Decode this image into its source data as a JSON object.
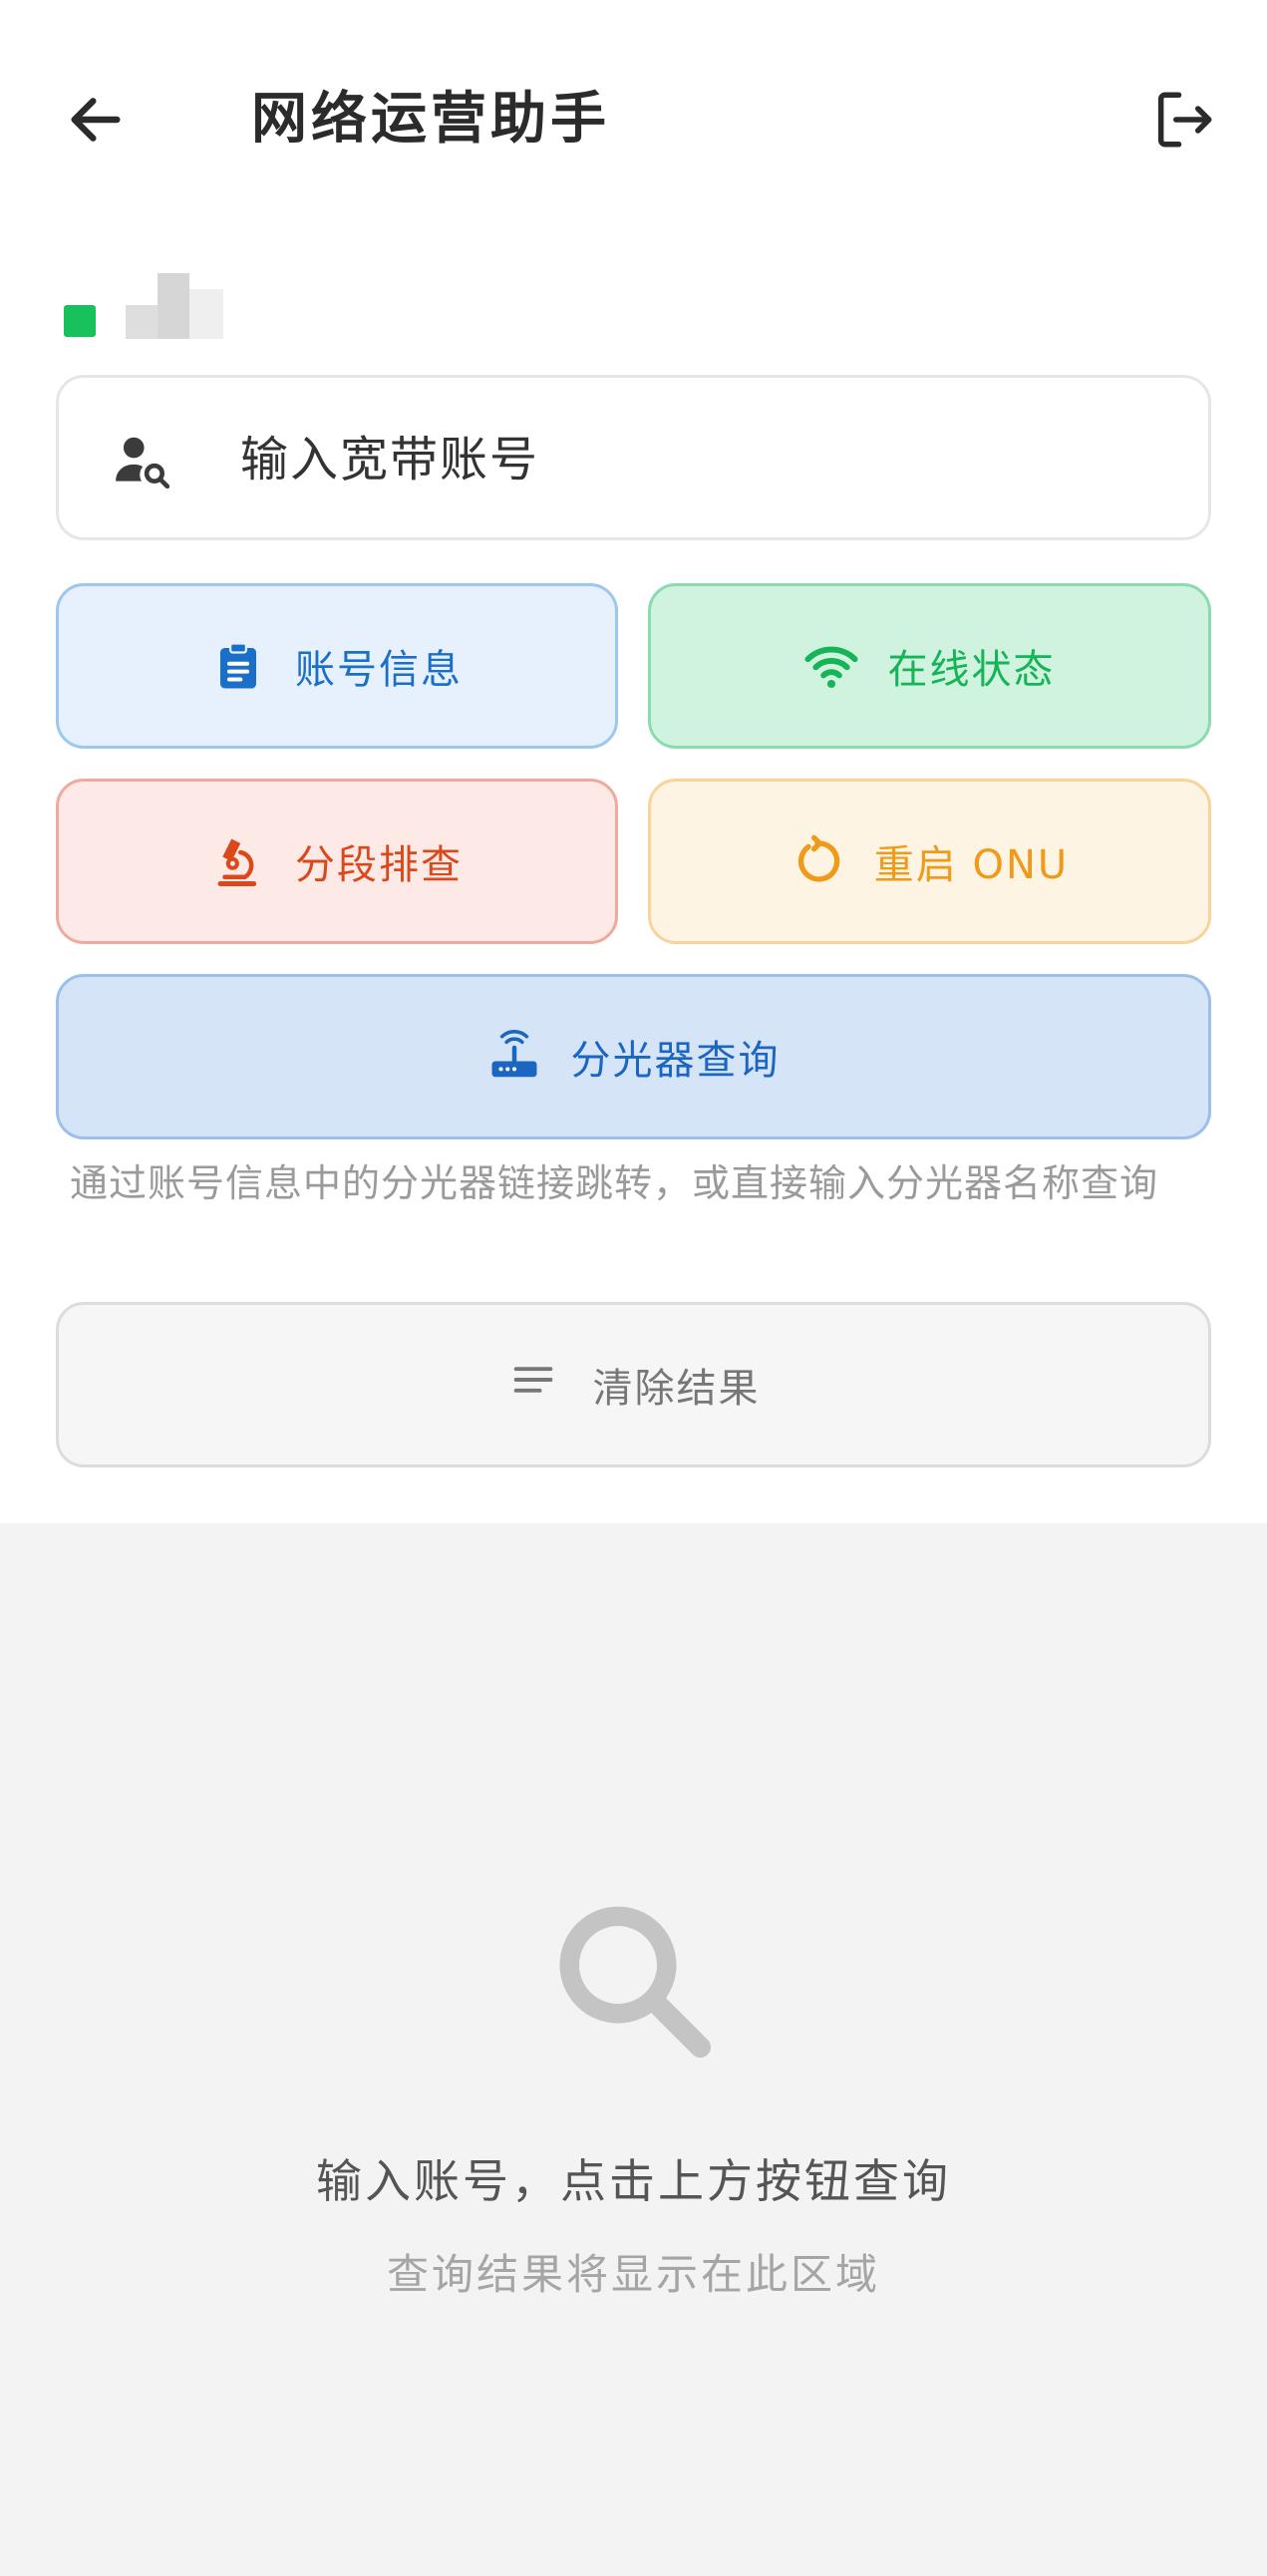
{
  "header": {
    "title": "网络运营助手",
    "back_icon": "arrow-left-icon",
    "logout_icon": "logout-icon"
  },
  "status": {
    "online_color": "#17c15b"
  },
  "search": {
    "placeholder": "输入宽带账号",
    "value": "",
    "icon": "user-search-icon"
  },
  "actions": {
    "account_info": {
      "label": "账号信息",
      "icon": "clipboard-icon",
      "color": "#1a6fc9"
    },
    "online_status": {
      "label": "在线状态",
      "icon": "wifi-icon",
      "color": "#14b457"
    },
    "segment_check": {
      "label": "分段排查",
      "icon": "microscope-icon",
      "color": "#d9491c"
    },
    "reboot_onu": {
      "label": "重启 ONU",
      "icon": "refresh-icon",
      "color": "#f09a1a"
    },
    "splitter_query": {
      "label": "分光器查询",
      "icon": "router-icon",
      "color": "#1b66c2"
    }
  },
  "hint": "通过账号信息中的分光器链接跳转，或直接输入分光器名称查询",
  "clear": {
    "label": "清除结果",
    "icon": "clear-lines-icon"
  },
  "result": {
    "empty_icon": "search-icon",
    "title": "输入账号，点击上方按钮查询",
    "subtitle": "查询结果将显示在此区域"
  }
}
